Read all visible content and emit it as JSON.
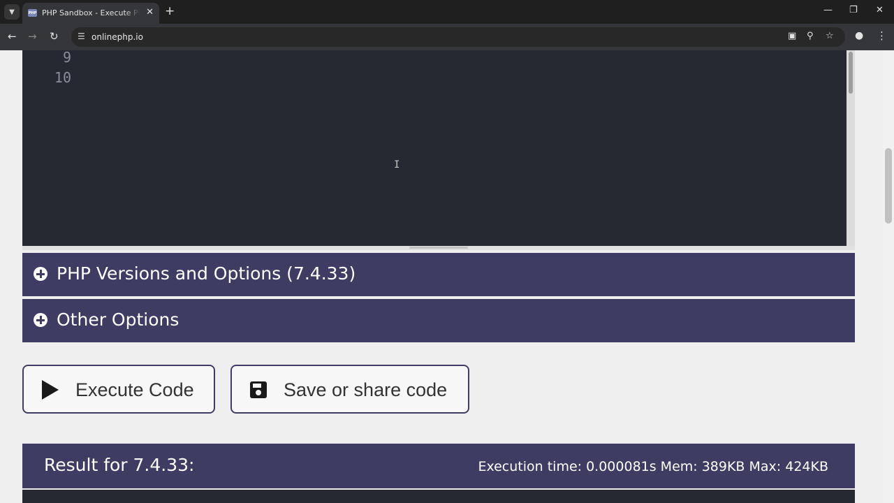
{
  "browser": {
    "tab_title": "PHP Sandbox - Execute PHP code online",
    "favicon_text": "PHP",
    "url": "onlinephp.io",
    "icons": {
      "tab_search": "chevron-down-icon",
      "close": "close-icon",
      "new_tab": "plus-icon",
      "back": "arrow-left-icon",
      "forward": "arrow-right-icon",
      "reload": "reload-icon",
      "site_info": "tune-icon",
      "cast": "cast-icon",
      "zoom": "zoom-icon",
      "bookmark": "star-icon",
      "profile": "person-icon",
      "menu": "kebab-icon"
    }
  },
  "editor": {
    "line_numbers": [
      "9",
      "10"
    ]
  },
  "panels": {
    "versions_label": "PHP Versions and Options (7.4.33)",
    "other_label": "Other Options"
  },
  "buttons": {
    "execute_label": "Execute Code",
    "save_label": "Save or share code"
  },
  "result": {
    "title": "Result for 7.4.33:",
    "stats": "Execution time: 0.000081s Mem: 389KB Max: 424KB"
  },
  "colors": {
    "panel": "#3f3c63",
    "editor_bg": "#272932",
    "page_bg": "#efefef"
  }
}
